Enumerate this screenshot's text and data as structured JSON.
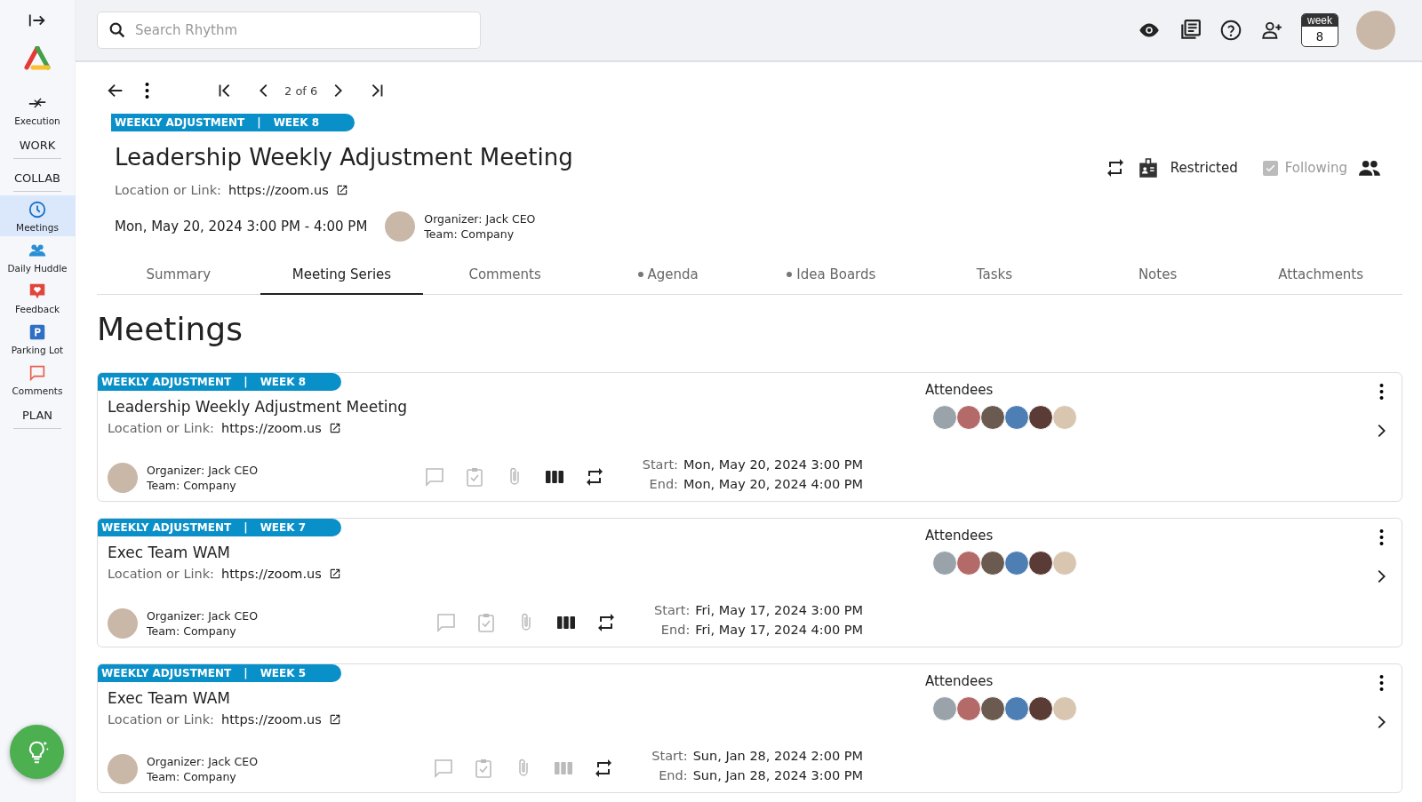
{
  "sidebar": {
    "items": [
      {
        "kind": "link",
        "label": "Execution",
        "selected": false
      },
      {
        "kind": "section",
        "label": "WORK"
      },
      {
        "kind": "section",
        "label": "COLLAB"
      },
      {
        "kind": "link",
        "label": "Meetings",
        "selected": true
      },
      {
        "kind": "link",
        "label": "Daily Huddle",
        "selected": false
      },
      {
        "kind": "link",
        "label": "Feedback",
        "selected": false
      },
      {
        "kind": "link",
        "label": "Parking Lot",
        "selected": false
      },
      {
        "kind": "link",
        "label": "Comments",
        "selected": false
      },
      {
        "kind": "section",
        "label": "PLAN"
      }
    ]
  },
  "topbar": {
    "search": {
      "placeholder": "Search Rhythm"
    },
    "week": {
      "label": "week",
      "number": "8"
    }
  },
  "pager": {
    "position": "2 of 6"
  },
  "meeting": {
    "ribbon": [
      "WEEKLY ADJUSTMENT",
      "|",
      "WEEK 8"
    ],
    "title": "Leadership Weekly Adjustment Meeting",
    "location_label": "Location or Link:",
    "location": "https://zoom.us",
    "when": "Mon, May 20, 2024 3:00 PM - 4:00 PM",
    "organizer_label": "Organizer:",
    "organizer": "Jack CEO",
    "team_label": "Team:",
    "team": "Company",
    "restricted": "Restricted",
    "following": {
      "label": "Following",
      "checked": true,
      "disabled": true
    }
  },
  "tabs": [
    {
      "label": "Summary",
      "selected": false,
      "dot": false
    },
    {
      "label": "Meeting Series",
      "selected": true,
      "dot": false
    },
    {
      "label": "Comments",
      "selected": false,
      "dot": false
    },
    {
      "label": "Agenda",
      "selected": false,
      "dot": true
    },
    {
      "label": "Idea Boards",
      "selected": false,
      "dot": true
    },
    {
      "label": "Tasks",
      "selected": false,
      "dot": false
    },
    {
      "label": "Notes",
      "selected": false,
      "dot": false
    },
    {
      "label": "Attachments",
      "selected": false,
      "dot": false
    }
  ],
  "heading": "Meetings",
  "meetings": [
    {
      "ribbon": [
        "WEEKLY ADJUSTMENT",
        "|",
        "WEEK 8"
      ],
      "title": "Leadership Weekly Adjustment Meeting",
      "location_label": "Location or Link:",
      "location": "https://zoom.us",
      "organizer_label": "Organizer:",
      "organizer": "Jack CEO",
      "team_label": "Team:",
      "team": "Company",
      "idea_board_active": true,
      "start_label": "Start:",
      "start": "Mon, May 20, 2024 3:00 PM",
      "end_label": "End:",
      "end": "Mon, May 20, 2024 4:00 PM",
      "attendees_label": "Attendees"
    },
    {
      "ribbon": [
        "WEEKLY ADJUSTMENT",
        "|",
        "WEEK 7"
      ],
      "title": "Exec Team WAM",
      "location_label": "Location or Link:",
      "location": "https://zoom.us",
      "organizer_label": "Organizer:",
      "organizer": "Jack CEO",
      "team_label": "Team:",
      "team": "Company",
      "idea_board_active": true,
      "start_label": "Start:",
      "start": "Fri, May 17, 2024 3:00 PM",
      "end_label": "End:",
      "end": "Fri, May 17, 2024 4:00 PM",
      "attendees_label": "Attendees"
    },
    {
      "ribbon": [
        "WEEKLY ADJUSTMENT",
        "|",
        "WEEK 5"
      ],
      "title": "Exec Team WAM",
      "location_label": "Location or Link:",
      "location": "https://zoom.us",
      "organizer_label": "Organizer:",
      "organizer": "Jack CEO",
      "team_label": "Team:",
      "team": "Company",
      "idea_board_active": false,
      "start_label": "Start:",
      "start": "Sun, Jan 28, 2024 2:00 PM",
      "end_label": "End:",
      "end": "Sun, Jan 28, 2024 3:00 PM",
      "attendees_label": "Attendees"
    }
  ]
}
